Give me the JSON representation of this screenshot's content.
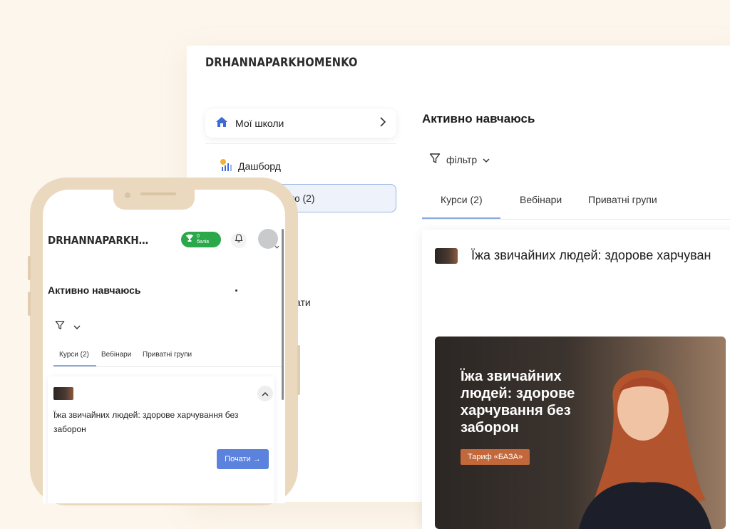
{
  "desktop": {
    "logo": "DRHANNAPARKHOMENKO",
    "sidebar": {
      "my_schools": "Мої школи",
      "dashboard": "Дашборд",
      "learning_active": "чаю (2)",
      "tail_item": "ати"
    },
    "main": {
      "title": "Активно навчаюсь",
      "filter_label": "фільтр",
      "tabs": [
        "Курси (2)",
        "Вебінари",
        "Приватні групи"
      ],
      "course_title": "Їжа звичайних людей: здорове харчуван",
      "banner": {
        "headline": "Їжа звичайних людей: здорове харчування без заборон",
        "badge": "Тариф «БАЗА»"
      }
    }
  },
  "mobile": {
    "logo": "DRHANNAPARKHOMEN...",
    "points_value": "0",
    "points_unit": "балів",
    "title": "Активно навчаюсь",
    "tabs": [
      "Курси (2)",
      "Вебінари",
      "Приватні групи"
    ],
    "course_title": "Їжа звичайних людей: здорове харчування без заборон",
    "start_button": "Почати →"
  },
  "colors": {
    "background": "#fdf6ec",
    "accent_blue": "#5b82dd",
    "points_green": "#2ba84a",
    "badge_orange": "#c3683a",
    "phone_frame": "#ead9bf"
  }
}
